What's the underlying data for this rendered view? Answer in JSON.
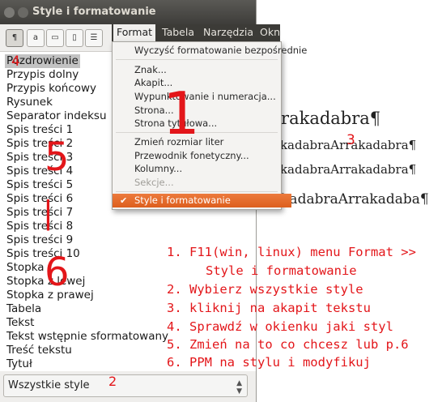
{
  "window": {
    "title": "Style i formatowanie"
  },
  "toolbar": {
    "buttons": [
      {
        "icon": "paragraph-styles-icon",
        "glyph": "¶"
      },
      {
        "icon": "character-styles-icon",
        "glyph": "a"
      },
      {
        "icon": "frame-styles-icon",
        "glyph": "▭"
      },
      {
        "icon": "page-styles-icon",
        "glyph": "▯"
      },
      {
        "icon": "list-styles-icon",
        "glyph": "☰"
      }
    ]
  },
  "style_list": {
    "items": [
      "Pozdrowienie",
      "Przypis dolny",
      "Przypis końcowy",
      "Rysunek",
      "Separator indeksu",
      "Spis treści 1",
      "Spis treści 2",
      "Spis treści 3",
      "Spis treści 4",
      "Spis treści 5",
      "Spis treści 6",
      "Spis treści 7",
      "Spis treści 8",
      "Spis treści 9",
      "Spis treści 10",
      "Stopka",
      "Stopka z lewej",
      "Stopka z prawej",
      "Tabela",
      "Tekst",
      "Tekst wstępnie sformatowany",
      "Treść tekstu",
      "Tytuł"
    ],
    "selected": "Pozdrowienie"
  },
  "filter": {
    "value": "Wszystkie style"
  },
  "menubar": {
    "items": [
      "Format",
      "Tabela",
      "Narzędzia",
      "Okn"
    ]
  },
  "format_menu": {
    "items": [
      "Wyczyść formatowanie bezpośrednie",
      "Znak...",
      "Akapit...",
      "Wypunktowanie i numeracja...",
      "Strona...",
      "Strona tytułowa...",
      "Zmień rozmiar liter",
      "Przewodnik fonetyczny...",
      "Kolumny...",
      "Sekcje...",
      "Style i formatowanie"
    ],
    "disabled": "Sekcje...",
    "highlighted": "Style i formatowanie"
  },
  "document": {
    "lines": [
      "rrakadabra¶",
      "akadabraArrakadabra¶",
      "akadabraArrakadabra¶",
      "akadabraArrakadaba¶"
    ]
  },
  "annotations": {
    "numbers": [
      "1",
      "2",
      "3",
      "4",
      "5",
      "6"
    ],
    "instructions": [
      "1. F11(win, linux) menu Format >>",
      "Style i formatowanie",
      "2. Wybierz wszystkie style",
      "3. kliknij na akapit tekstu",
      "4. Sprawdź w okienku jaki styl",
      "5. Zmień na to co chcesz lub p.6",
      "6. PPM na stylu i modyfikuj"
    ]
  },
  "colors": {
    "highlight": "#e86d2e",
    "annotation": "#e3161a",
    "titlebar": "#3e3d3a"
  }
}
